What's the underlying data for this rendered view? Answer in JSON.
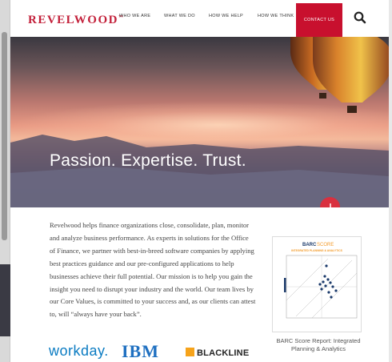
{
  "header": {
    "logo": "REVELWOOD",
    "nav": [
      "WHO WE ARE",
      "WHAT WE DO",
      "HOW WE HELP",
      "HOW WE THINK"
    ],
    "contact": "CONTACT US",
    "search_icon": "search-icon"
  },
  "hero": {
    "headline": "Passion. Expertise. Trust.",
    "scroll_icon": "arrow-down-icon"
  },
  "intro": {
    "text": "Revelwood helps finance organizations close, consolidate, plan, monitor and analyze business performance. As experts in solutions for the Office of Finance, we partner with best-in-breed software companies by applying best practices guidance and our pre-configured applications to help businesses achieve their full potential. Our mission is to help you gain the insight you need to disrupt your industry and the world. Our team lives by our Core Values, is committed to your success and, as our clients can attest to, will “always have your back”."
  },
  "barc": {
    "brand": "BARC",
    "score_word": "SCORE",
    "subtitle": "INTEGRATED PLANNING & ANALYTICS",
    "caption": "BARC Score Report: Integrated Planning & Analytics"
  },
  "partners": {
    "workday": "workday.",
    "ibm": "IBM",
    "blackline": "BLACKLINE"
  },
  "colors": {
    "brand_red": "#c8102e",
    "logo_red": "#c3203a"
  }
}
